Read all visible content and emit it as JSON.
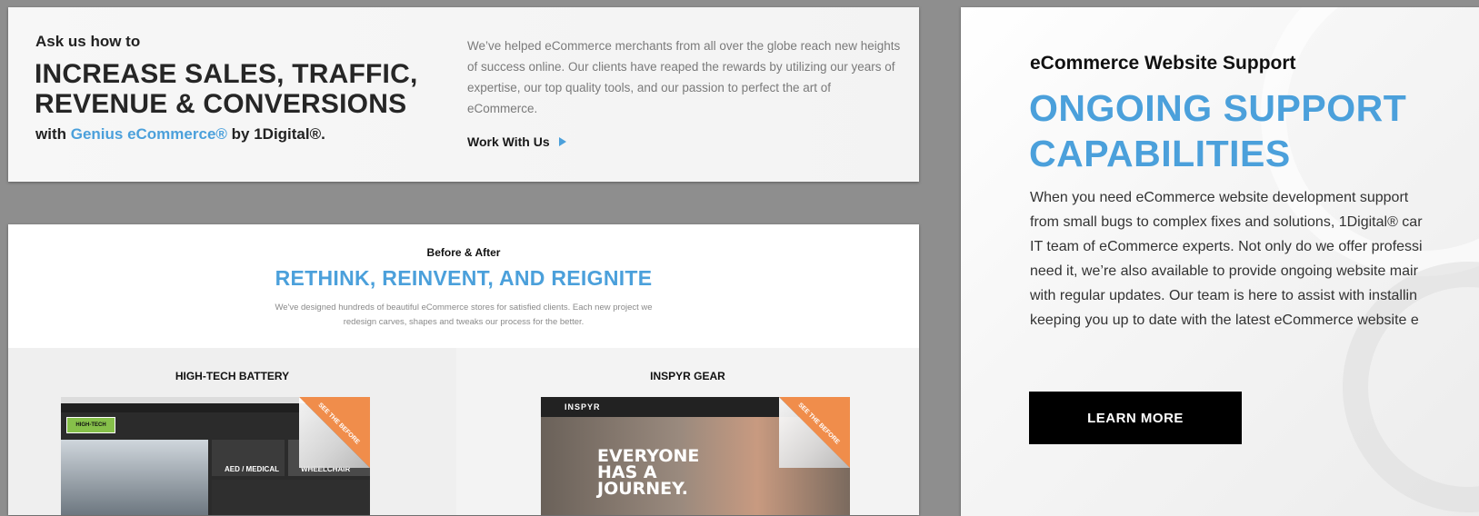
{
  "ask_card": {
    "eyebrow": "Ask us how to",
    "headline_line1": "INCREASE SALES, TRAFFIC,",
    "headline_line2": "REVENUE & CONVERSIONS",
    "with_prefix": "with ",
    "brand": "Genius eCommerce®",
    "with_suffix": " by 1Digital®.",
    "body": "We’ve helped eCommerce merchants from all over the globe reach new heights of success online. Our clients have reaped the rewards by utilizing our years of expertise, our top quality tools, and our passion to perfect the art of eCommerce.",
    "cta_label": "Work With Us",
    "accent_color": "#4ba0db"
  },
  "before_after": {
    "eyebrow": "Before & After",
    "title": "RETHINK, REINVENT, AND REIGNITE",
    "desc_line1": "We've designed hundreds of beautiful eCommerce stores for satisfied clients. Each new project we",
    "desc_line2": "redesign carves, shapes and tweaks our process for the better.",
    "projects": [
      {
        "name": "HIGH-TECH BATTERY",
        "logo": "HIGH-TECH",
        "tiles": [
          "AED / MEDICAL",
          "WHEELCHAIR"
        ],
        "peel_label": "SEE THE BEFORE"
      },
      {
        "name": "INSPYR GEAR",
        "logo": "INSPYR",
        "hero_line1": "EVERYONE",
        "hero_line2": "HAS A",
        "hero_line3": "JOURNEY.",
        "peel_label": "SEE THE BEFORE"
      }
    ]
  },
  "support_card": {
    "eyebrow": "eCommerce Website Support",
    "title_line1": "ONGOING SUPPORT",
    "title_line2": "CAPABILITIES",
    "body_lines": [
      "When you need eCommerce website development support",
      "from small bugs to complex fixes and solutions, 1Digital® car",
      "IT team of eCommerce experts. Not only do we offer professi",
      "need it, we’re also available to provide ongoing website mair",
      "with regular updates. Our team is here to assist with installin",
      "keeping you up to date with the latest eCommerce website e"
    ],
    "cta_label": "LEARN MORE"
  }
}
